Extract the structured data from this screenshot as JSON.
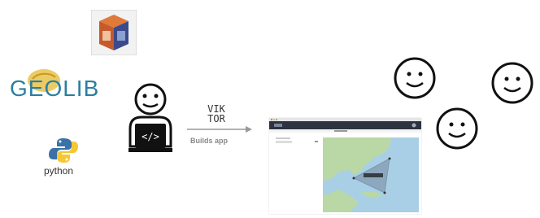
{
  "logos": {
    "geolib_text": "GEOLIB",
    "python_text": "python",
    "viktor_line1": "VIK",
    "viktor_line2": "TOR"
  },
  "arrow_label": "Builds app",
  "colors": {
    "geolib_blue": "#2a7fa0",
    "cube_orange": "#e0763a",
    "cube_navy": "#3b4a8a",
    "app_header": "#2d3340",
    "sea_blue": "#a8cfe6",
    "land_green": "#b9d8a6"
  },
  "icons": {
    "developer": "developer-laptop-icon",
    "smiley": "smiley-face-icon",
    "cube": "geo-cube-logo",
    "python": "python-logo"
  }
}
